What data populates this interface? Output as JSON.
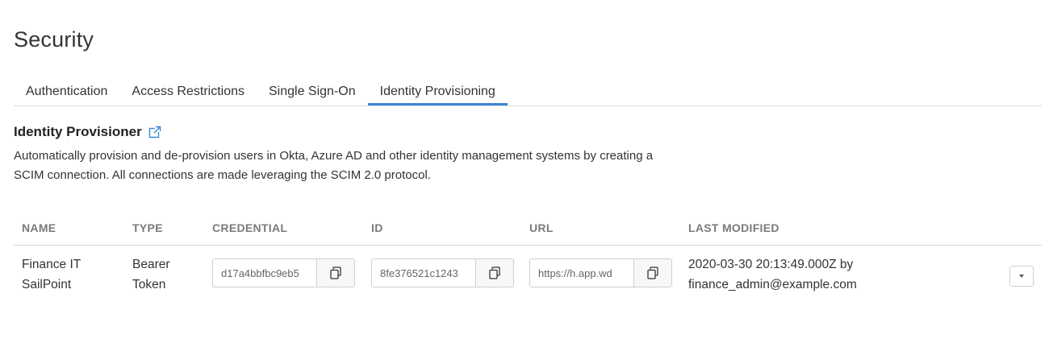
{
  "page": {
    "title": "Security"
  },
  "tabs": [
    {
      "label": "Authentication"
    },
    {
      "label": "Access Restrictions"
    },
    {
      "label": "Single Sign-On"
    },
    {
      "label": "Identity Provisioning",
      "active": true
    }
  ],
  "section": {
    "title": "Identity Provisioner",
    "description_line1": "Automatically provision and de-provision users in Okta, Azure AD and other identity management systems by creating a",
    "description_line2": "SCIM connection. All connections are made leveraging the SCIM 2.0 protocol."
  },
  "table": {
    "headers": {
      "name": "NAME",
      "type": "TYPE",
      "credential": "CREDENTIAL",
      "id": "ID",
      "url": "URL",
      "last_modified": "LAST MODIFIED"
    },
    "rows": [
      {
        "name_line1": "Finance IT",
        "name_line2": "SailPoint",
        "type_line1": "Bearer",
        "type_line2": "Token",
        "credential": "d17a4bbfbc9eb5",
        "id": "8fe376521c1243",
        "url": "https://h.app.wd",
        "last_modified_line1": "2020-03-30 20:13:49.000Z by",
        "last_modified_line2": "finance_admin@example.com"
      }
    ]
  },
  "icons": {
    "external_link": "external-link-icon",
    "copy": "copy-icon",
    "caret": "caret-down-icon"
  },
  "colors": {
    "accent": "#3a87d6",
    "header_text": "#7a7a7a"
  }
}
